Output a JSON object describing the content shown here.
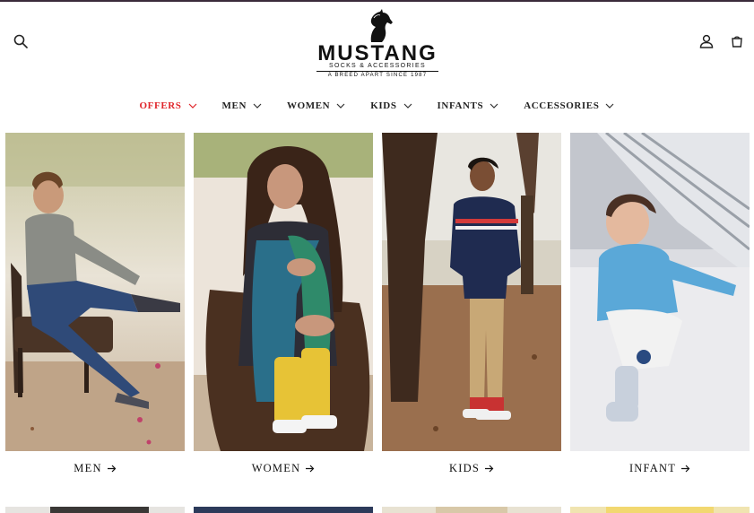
{
  "header": {
    "logo": {
      "brand": "MUSTANG",
      "tagline": "SOCKS & ACCESSORIES",
      "sub": "A BREED APART  SINCE 1987"
    },
    "icons": {
      "search": "search-icon",
      "account": "user-icon",
      "cart": "cart-icon"
    }
  },
  "nav": {
    "items": [
      {
        "label": "OFFERS",
        "color": "#e0252b"
      },
      {
        "label": "MEN"
      },
      {
        "label": "WOMEN"
      },
      {
        "label": "KIDS"
      },
      {
        "label": "INFANTS"
      },
      {
        "label": "ACCESSORIES"
      }
    ]
  },
  "categories": [
    {
      "label": "MEN"
    },
    {
      "label": "WOMEN"
    },
    {
      "label": "KIDS"
    },
    {
      "label": "INFANT"
    }
  ],
  "colors": {
    "accent": "#e0252b",
    "text": "#1a1a1a",
    "background": "#ffffff"
  }
}
